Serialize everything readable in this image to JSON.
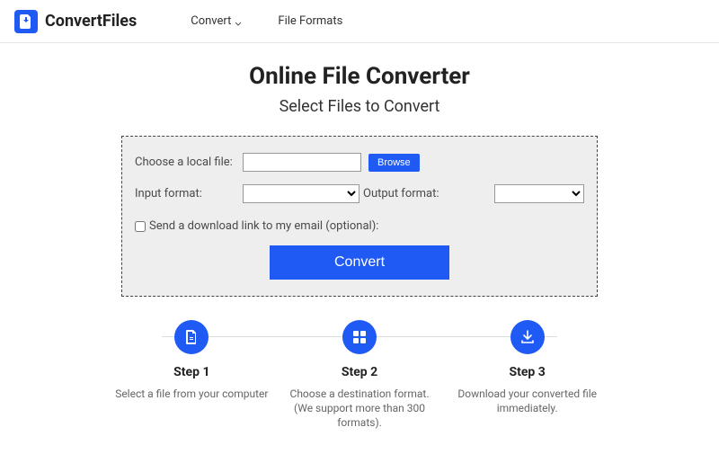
{
  "header": {
    "brand": "ConvertFiles",
    "nav": {
      "convert": "Convert",
      "file_formats": "File Formats"
    }
  },
  "hero": {
    "title": "Online File Converter",
    "subtitle": "Select Files to Convert"
  },
  "form": {
    "choose_label": "Choose a local file:",
    "file_value": "",
    "browse_label": "Browse",
    "input_format_label": "Input format:",
    "input_format_value": "",
    "output_format_label": "Output format:",
    "output_format_value": "",
    "email_label": "Send a download link to my email (optional):",
    "convert_label": "Convert"
  },
  "steps": [
    {
      "title": "Step 1",
      "desc": "Select a file from your computer"
    },
    {
      "title": "Step 2",
      "desc": "Choose a destination format. (We support more than 300 formats)."
    },
    {
      "title": "Step 3",
      "desc": "Download your converted file immediately."
    }
  ]
}
